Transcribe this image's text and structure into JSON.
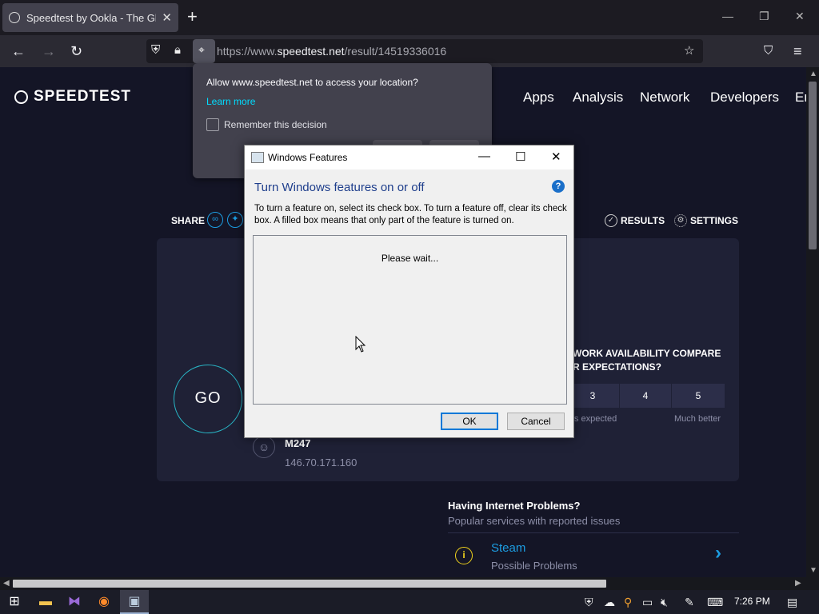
{
  "browser": {
    "tab_title": "Speedtest by Ookla - The Global Broadband Speed Test",
    "tab_close": "✕",
    "new_tab": "+",
    "url_prefix": "https://www.",
    "url_domain": "speedtest.net",
    "url_path": "/result/14519336016"
  },
  "permission": {
    "title": "Allow www.speedtest.net to access your location?",
    "learn_more": "Learn more",
    "remember": "Remember this decision"
  },
  "site": {
    "logo": "SPEEDTEST",
    "nav": [
      "Apps",
      "Analysis",
      "Network",
      "Developers",
      "En"
    ],
    "share_label": "SHARE",
    "results_label": "RESULTS",
    "settings_label": "SETTINGS",
    "go_label": "GO",
    "availability_line1": "WORK AVAILABILITY COMPARE",
    "availability_line2": "R EXPECTATIONS?",
    "ratings": [
      "3",
      "4",
      "5"
    ],
    "rating_low": "s expected",
    "rating_high": "Much better",
    "isp_name": "M247",
    "isp_ip": "146.70.171.160",
    "problems_title": "Having Internet Problems?",
    "problems_subtitle": "Popular services with reported issues",
    "service_name": "Steam",
    "service_status": "Possible Problems"
  },
  "dialog": {
    "title": "Windows Features",
    "heading": "Turn Windows features on or off",
    "description": "To turn a feature on, select its check box. To turn a feature off, clear its check box. A filled box means that only part of the feature is turned on.",
    "waiting": "Please wait...",
    "ok": "OK",
    "cancel": "Cancel",
    "help": "?"
  },
  "taskbar": {
    "time": "7:26 PM"
  },
  "colors": {
    "page_bg": "#141526",
    "card_bg": "#1f2136",
    "accent_blue": "#1c9de2",
    "go_ring": "#28b5c5",
    "dialog_heading": "#1e3e8c"
  }
}
